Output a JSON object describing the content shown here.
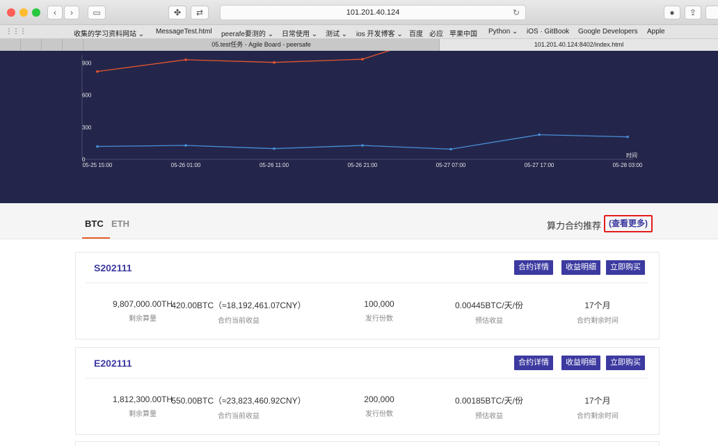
{
  "browser": {
    "url": "101.201.40.124",
    "bookmarks": [
      "收集的学习资料网站 ⌄",
      "MessageTest.html",
      "peerafe要测的 ⌄",
      "日常使用 ⌄",
      "测试 ⌄",
      "ios 开发博客 ⌄",
      "百度",
      "必应",
      "苹果中国",
      "Python ⌄",
      "iOS · GitBook",
      "Google Developers",
      "Apple"
    ],
    "tabs": [
      "05.test任务 - Agile Board - peersafe",
      "101.201.40.124:8402/index.html"
    ]
  },
  "chart_data": {
    "type": "line",
    "xlabel": "时间",
    "categories": [
      "05-25 15:00",
      "05-26 01:00",
      "05-26 11:00",
      "05-26 21:00",
      "05-27 07:00",
      "05-27 17:00",
      "05-28 03:00"
    ],
    "y_ticks": [
      "900",
      "600",
      "300",
      "0"
    ],
    "ylim": [
      0,
      1020
    ],
    "series": [
      {
        "color": "#e8552f",
        "values": [
          820,
          930,
          905,
          935,
          1200
        ]
      },
      {
        "color": "#4a8fd9",
        "values": [
          120,
          130,
          100,
          130,
          95,
          230,
          210
        ]
      }
    ]
  },
  "subnav": {
    "tabs": [
      "BTC",
      "ETH"
    ],
    "active_tab": "BTC",
    "recommend_label": "算力合约推荐",
    "more_link": "(查看更多)"
  },
  "cards": [
    {
      "title": "S202111",
      "actions": [
        "合约详情",
        "收益明细",
        "立即购买"
      ],
      "stats": [
        {
          "value": "9,807,000.00TH",
          "label": "剩余算量"
        },
        {
          "value": "420.00BTC（≈18,192,461.07CNY）",
          "label": "合约当前收益"
        },
        {
          "value": "100,000",
          "label": "发行份数"
        },
        {
          "value": "0.00445BTC/天/份",
          "label": "预估收益"
        },
        {
          "value": "17个月",
          "label": "合约剩余时间"
        }
      ]
    },
    {
      "title": "E202111",
      "actions": [
        "合约详情",
        "收益明细",
        "立即购买"
      ],
      "stats": [
        {
          "value": "1,812,300.00TH",
          "label": "剩余算量"
        },
        {
          "value": "550.00BTC（≈23,823,460.92CNY）",
          "label": "合约当前收益"
        },
        {
          "value": "200,000",
          "label": "发行份数"
        },
        {
          "value": "0.00185BTC/天/份",
          "label": "预估收益"
        },
        {
          "value": "17个月",
          "label": "合约剩余时间"
        }
      ]
    }
  ],
  "colors": {
    "accent": "#3c3aa0",
    "chart_bg": "#23264a",
    "highlight": "#e21d1d",
    "tab_underline": "#e85d2a"
  }
}
